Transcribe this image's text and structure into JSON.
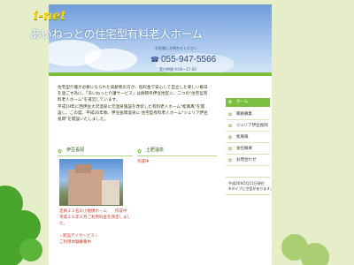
{
  "header": {
    "brand": "i-net",
    "title": "あいねっとの住宅型有料老人ホーム",
    "tagline": "お気軽にお問合せください",
    "phone": "055-947-5566",
    "fax": "受付時間 9:00〜17:00"
  },
  "intro": {
    "p1": "住宅型介護が必要になられた高齢者の方が、低料金で安心して自立した楽しい毎日を過ごす為に、「あいねっと介護サービス」は静岡県伊豆地区に、二つの\"住宅型有料老人ホーム\"を運営しています。",
    "p2": "平成19年に西伊豆大沢温泉に元温泉施設を改装した有料老人ホーム\"松風風\"を開設し、この度、平成26年春、伊豆長岡温泉に 住宅型有料老人ホーム\"ジュリア伊豆長岡\"を開設いたしました。"
  },
  "sections": {
    "left": "伊豆長岡",
    "right": "土肥温泉",
    "right_status": "作成中"
  },
  "facility_notes": {
    "line1": "定員２２名の小規模ホーム　　作成中",
    "line2": "平成２６年６月ご利用料金を改定しました。",
    "line3": "☆新設デイサービス☆",
    "line4": "ご利用体験募集中"
  },
  "nav": {
    "items": [
      "ホーム",
      "職員募集",
      "ジュリア伊豆長岡",
      "松風風",
      "会社概要",
      "お問合わせ"
    ]
  },
  "update": {
    "line1": "平成26年5月11日現在",
    "line2": "※タイプに空室があります。"
  }
}
